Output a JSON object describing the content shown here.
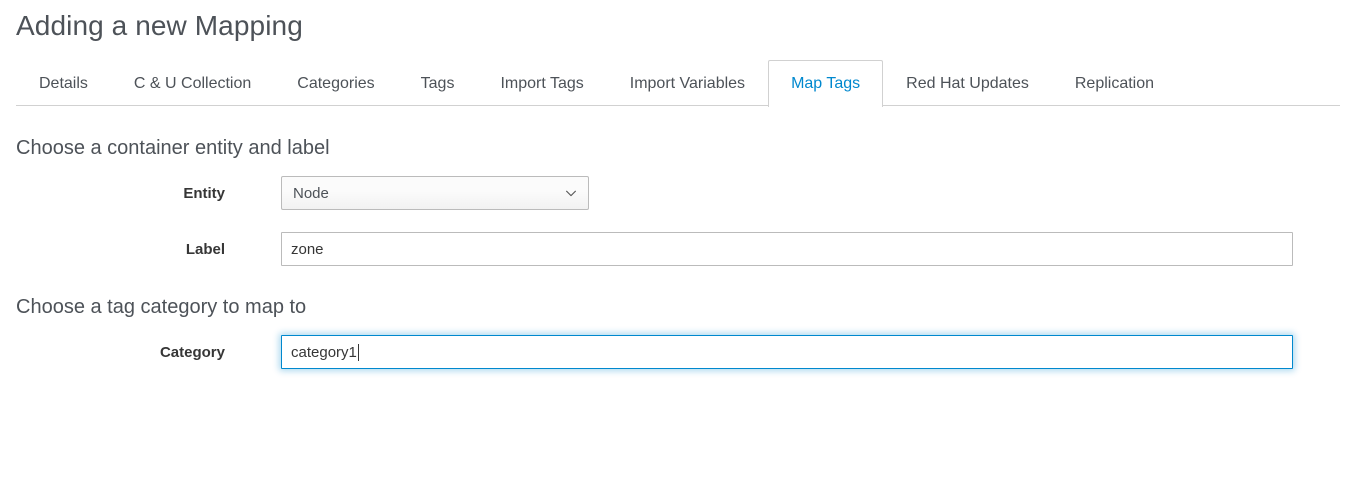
{
  "page": {
    "title": "Adding a new Mapping"
  },
  "tabs": {
    "items": [
      {
        "label": "Details",
        "active": false
      },
      {
        "label": "C & U Collection",
        "active": false
      },
      {
        "label": "Categories",
        "active": false
      },
      {
        "label": "Tags",
        "active": false
      },
      {
        "label": "Import Tags",
        "active": false
      },
      {
        "label": "Import Variables",
        "active": false
      },
      {
        "label": "Map Tags",
        "active": true
      },
      {
        "label": "Red Hat Updates",
        "active": false
      },
      {
        "label": "Replication",
        "active": false
      }
    ],
    "active_label": "Map Tags"
  },
  "sections": {
    "entity": {
      "heading": "Choose a container entity and label",
      "entity_label": "Entity",
      "entity_value": "Node",
      "entity_icon": "chevron-down-icon",
      "label_label": "Label",
      "label_value": "zone",
      "label_placeholder": ""
    },
    "category": {
      "heading": "Choose a tag category to map to",
      "category_label": "Category",
      "category_value": "category1",
      "category_placeholder": "",
      "focused": true
    }
  },
  "colors": {
    "accent": "#0088ce",
    "text": "#363636",
    "muted_text": "#4d5258",
    "border": "#bbbbbb",
    "divider": "#d1d1d1"
  }
}
